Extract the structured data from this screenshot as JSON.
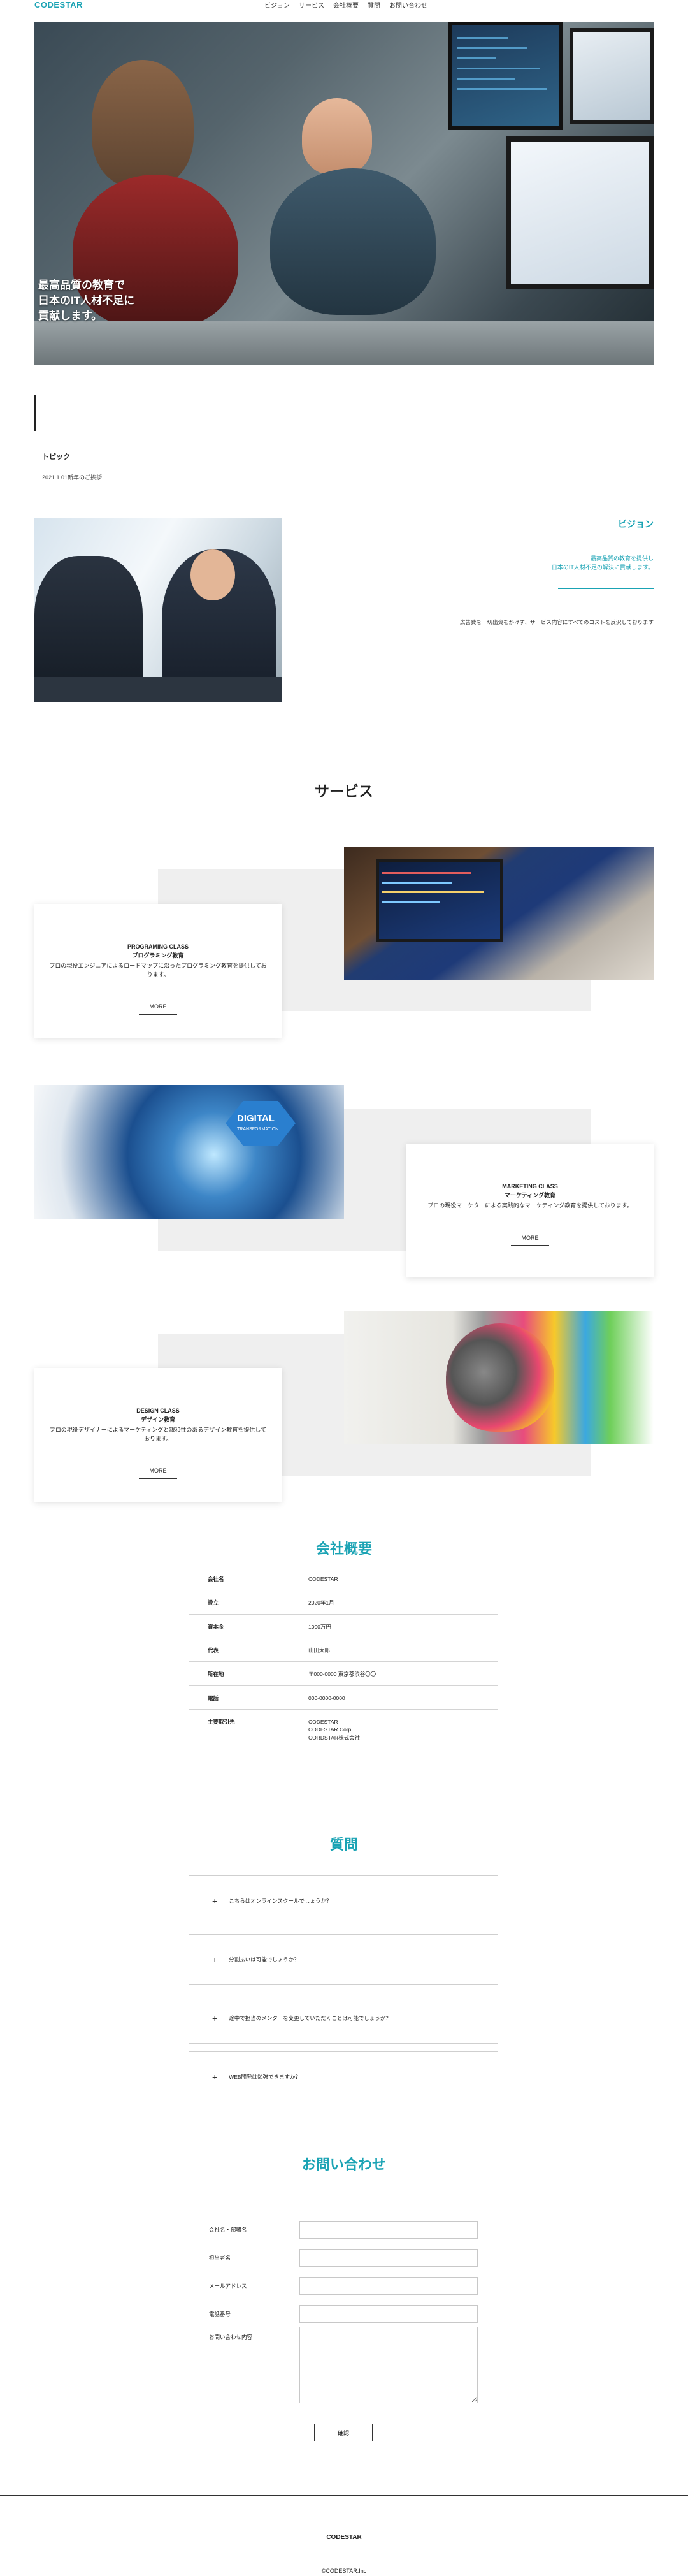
{
  "header": {
    "logo": "CODESTAR",
    "nav": [
      "ビジョン",
      "サービス",
      "会社概要",
      "質問",
      "お問い合わせ"
    ]
  },
  "hero": {
    "headline_line1": "最高品質の教育で",
    "headline_line2": "日本のIT人材不足に",
    "headline_line3": "貢献します。"
  },
  "topics": {
    "title": "トピック",
    "date_item": "2021.1.01新年のご挨拶"
  },
  "vision": {
    "title": "ビジョン",
    "sub_line1": "最高品質の教育を提供し",
    "sub_line2": "日本のIT人材不足の解決に貢献します。",
    "description": "広告費を一切出資をかけず、サービス内容にすべてのコストを反沢しております"
  },
  "services": {
    "title": "サービス",
    "items": [
      {
        "class_label": "PROGRAMING CLASS",
        "name": "プログラミング教育",
        "desc": "プロの現役エンジニアによるロードマップに沿ったプログラミング教育を提供しております。",
        "more": "MORE"
      },
      {
        "class_label": "MARKETING CLASS",
        "name": "マーケティング教育",
        "desc": "プロの現役マーケターによる実践的なマーケティング教育を提供しております。",
        "more": "MORE"
      },
      {
        "class_label": "DESIGN CLASS",
        "name": "デザイン教育",
        "desc": "プロの現役デザイナーによるマーケティングと親和性のあるデザイン教育を提供しております。",
        "more": "MORE"
      }
    ],
    "digital_text_1": "DIGITAL",
    "digital_text_2": "TRANSFORMATION"
  },
  "company": {
    "title": "会社概要",
    "rows": [
      {
        "k": "会社名",
        "v": "CODESTAR"
      },
      {
        "k": "設立",
        "v": "2020年1月"
      },
      {
        "k": "資本金",
        "v": "1000万円"
      },
      {
        "k": "代表",
        "v": "山田太郎"
      },
      {
        "k": "所在地",
        "v": "〒000-0000 東京都渋谷〇〇"
      },
      {
        "k": "電話",
        "v": "000-0000-0000"
      },
      {
        "k": "主要取引先",
        "v1": "CODESTAR",
        "v2": "CODESTAR Corp",
        "v3": "CORDSTAR株式会社"
      }
    ]
  },
  "faq": {
    "title": "質問",
    "items": [
      "こちらはオンラインスクールでしょうか？",
      "分割払いは可能でしょうか？",
      "途中で担当のメンターを変更していただくことは可能でしょうか？",
      "WEB開発は勉強できますか？"
    ]
  },
  "contact": {
    "title": "お問い合わせ",
    "labels": [
      "会社名・部署名",
      "担当者名",
      "メールアドレス",
      "電話番号",
      "お問い合わせ内容"
    ],
    "submit": "確認"
  },
  "footer": {
    "logo": "CODESTAR",
    "copyright": "©CODESTAR.Inc"
  },
  "colors": {
    "accent": "#1aa3b4",
    "text": "#222222",
    "gray_block": "#efefef"
  }
}
